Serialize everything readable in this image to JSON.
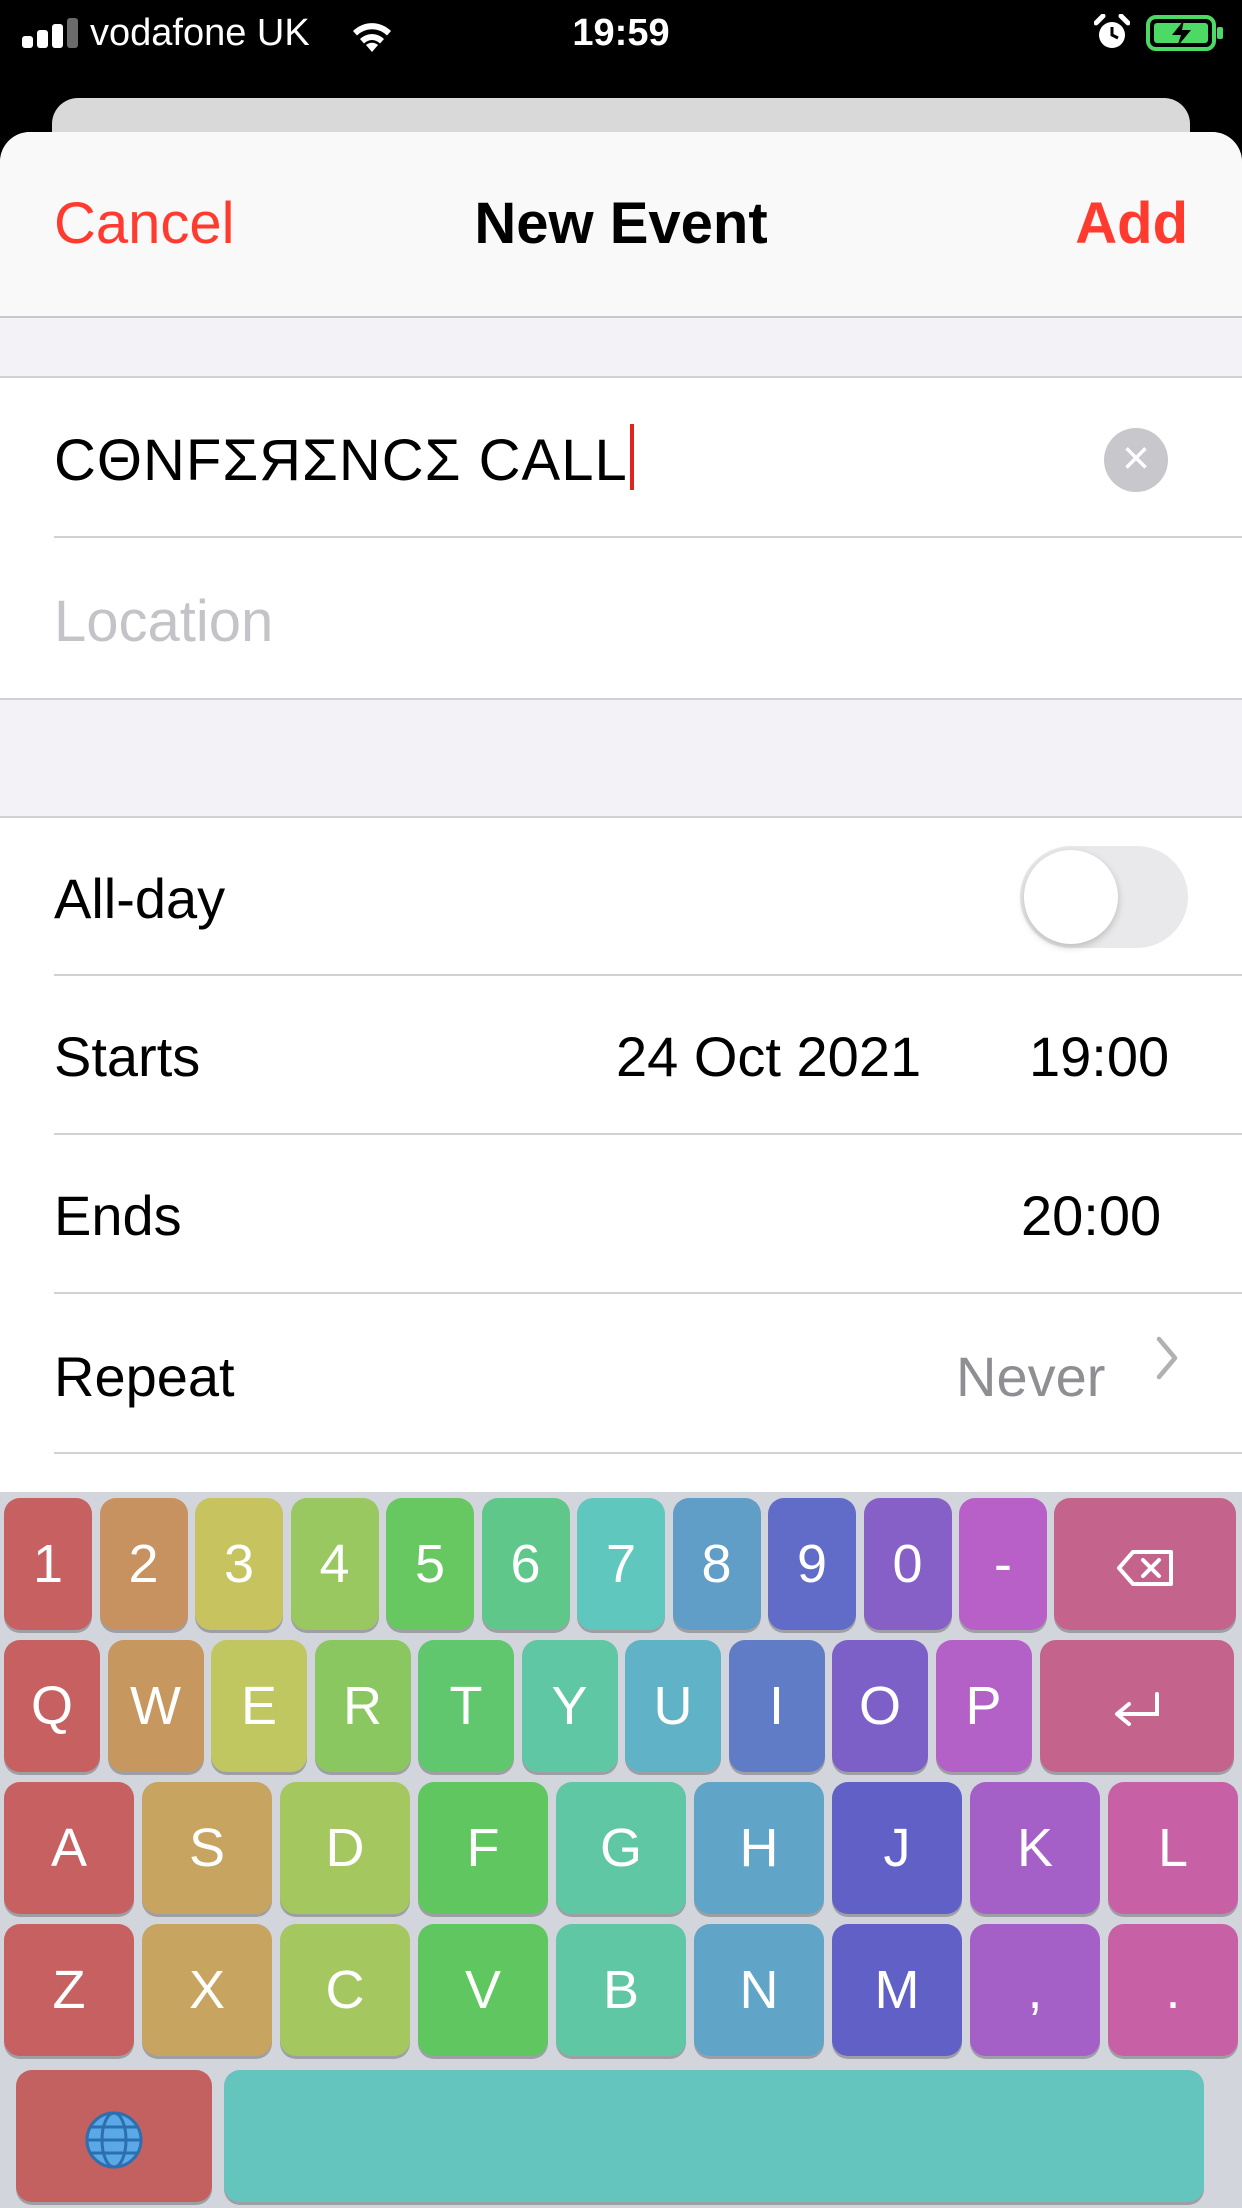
{
  "status_bar": {
    "carrier": "vodafone UK",
    "time": "19:59",
    "icons": [
      "signal-icon",
      "wifi-icon",
      "alarm-icon",
      "battery-charging-icon"
    ]
  },
  "nav": {
    "cancel": "Cancel",
    "title": "New Event",
    "add": "Add"
  },
  "event": {
    "title_value": "CΘNFΣЯΣNCΣ CΑLL",
    "location_placeholder": "Location"
  },
  "details": {
    "all_day_label": "All-day",
    "all_day_on": false,
    "starts_label": "Starts",
    "starts_date": "24 Oct 2021",
    "starts_time": "19:00",
    "ends_label": "Ends",
    "ends_time": "20:00",
    "repeat_label": "Repeat",
    "repeat_value": "Never"
  },
  "keyboard": {
    "row1": [
      "1",
      "2",
      "3",
      "4",
      "5",
      "6",
      "7",
      "8",
      "9",
      "0",
      "-"
    ],
    "row2": [
      "Q",
      "W",
      "E",
      "R",
      "T",
      "Y",
      "U",
      "I",
      "O",
      "P"
    ],
    "row3": [
      "A",
      "S",
      "D",
      "F",
      "G",
      "H",
      "J",
      "K",
      "L"
    ],
    "row4": [
      "Z",
      "X",
      "C",
      "V",
      "B",
      "N",
      "M",
      ",",
      "."
    ],
    "icons": [
      "delete-icon",
      "return-icon",
      "globe-icon"
    ]
  },
  "colors": {
    "accent": "#ff3b30",
    "caret": "#e0261c"
  }
}
